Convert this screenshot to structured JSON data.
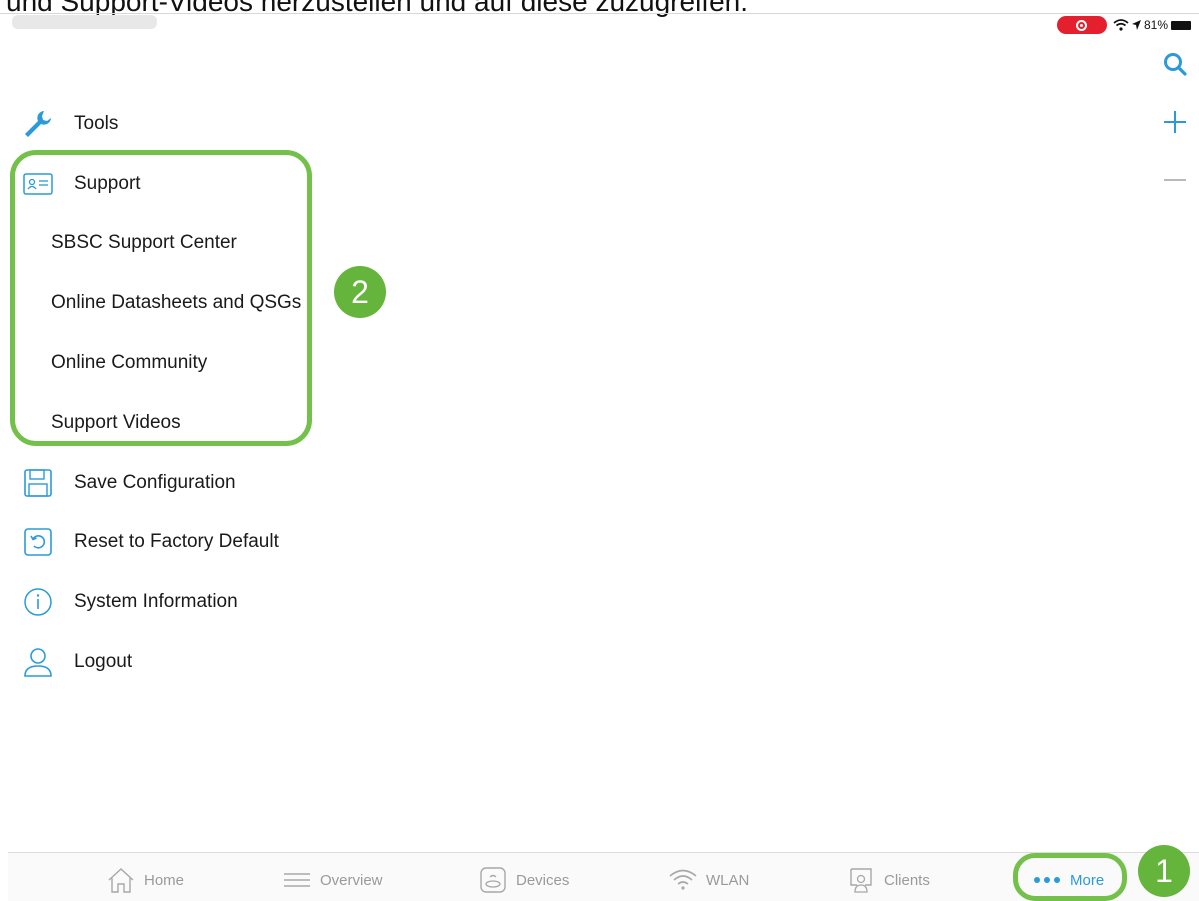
{
  "caption": "und Support-Videos herzustellen und auf diese zuzugreifen.",
  "status_bar": {
    "battery": "81%"
  },
  "right_tools": [
    "search-icon",
    "plus-icon",
    "minus-icon"
  ],
  "menu": {
    "tools": "Tools",
    "support": "Support",
    "support_items": [
      "SBSC Support Center",
      "Online Datasheets and QSGs",
      "Online Community",
      "Support Videos"
    ],
    "save": "Save Configuration",
    "reset": "Reset to Factory Default",
    "sysinfo": "System Information",
    "logout": "Logout"
  },
  "annotations": {
    "badge1": "1",
    "badge2": "2"
  },
  "tabs": {
    "home": "Home",
    "overview": "Overview",
    "devices": "Devices",
    "wlan": "WLAN",
    "clients": "Clients",
    "more": "More"
  },
  "colors": {
    "accent": "#2a9bd8",
    "highlight": "#73c04a",
    "badge": "#65b43c",
    "record": "#e5202e"
  }
}
